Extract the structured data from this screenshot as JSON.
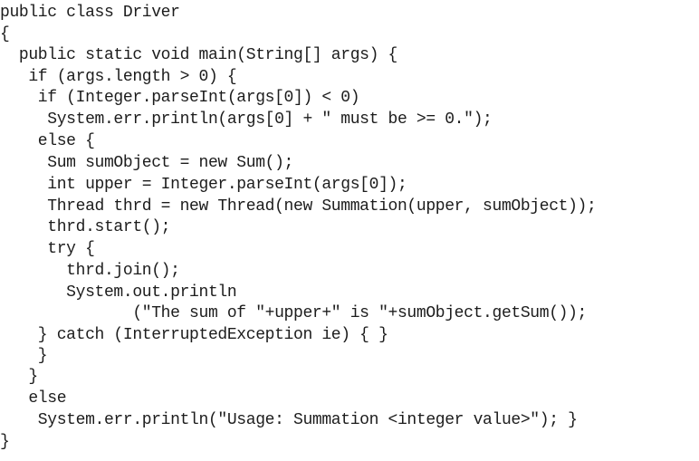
{
  "code": {
    "lines": [
      "public class Driver",
      "{",
      "  public static void main(String[] args) {",
      "   if (args.length > 0) {",
      "    if (Integer.parseInt(args[0]) < 0)",
      "     System.err.println(args[0] + \" must be >= 0.\");",
      "    else {",
      "     Sum sumObject = new Sum();",
      "     int upper = Integer.parseInt(args[0]);",
      "     Thread thrd = new Thread(new Summation(upper, sumObject));",
      "     thrd.start();",
      "     try {",
      "       thrd.join();",
      "       System.out.println",
      "              (\"The sum of \"+upper+\" is \"+sumObject.getSum());",
      "    } catch (InterruptedException ie) { }",
      "    }",
      "   }",
      "   else",
      "    System.err.println(\"Usage: Summation <integer value>\"); }",
      "}"
    ]
  }
}
